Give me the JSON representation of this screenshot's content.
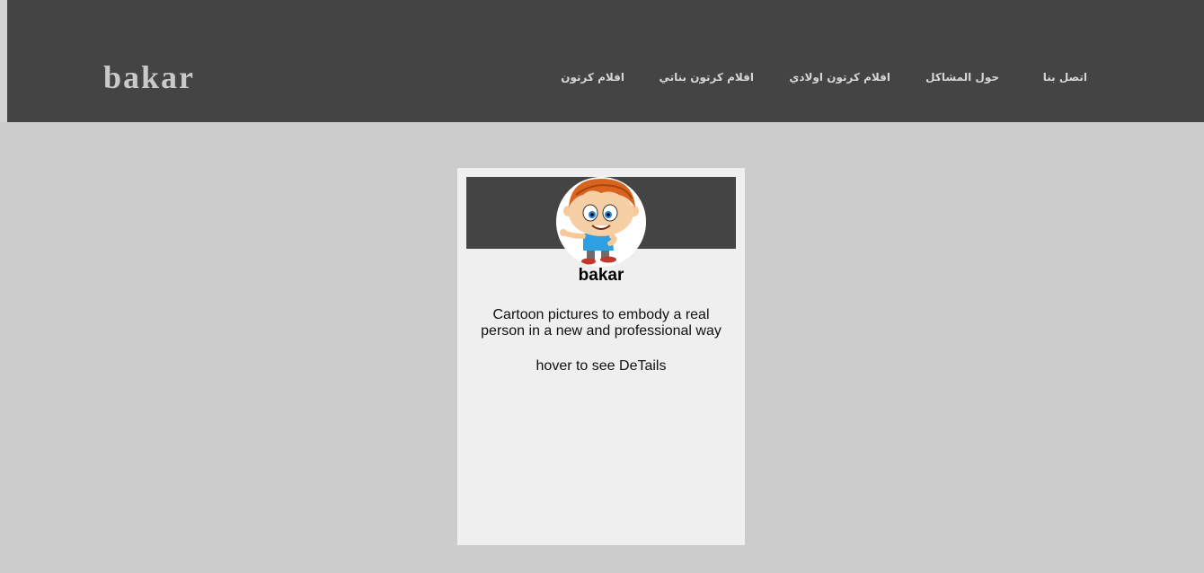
{
  "header": {
    "logo": "bakar",
    "nav": [
      {
        "label": "اتصل بنا"
      },
      {
        "label": "حول المشاكل"
      },
      {
        "label": "افلام كرتون اولادي"
      },
      {
        "label": "افلام كرتون بناتي"
      },
      {
        "label": "افلام كرتون"
      }
    ]
  },
  "card": {
    "name": "bakar",
    "description": "Cartoon pictures to embody a real person in a new and professional way",
    "hint": "hover to see DeTails",
    "avatar_icon": "cartoon-boy-avatar"
  },
  "colors": {
    "page_background": "#cccccc",
    "navbar": "#444444",
    "card": "#efefef",
    "nav_text": "#d6d6d6",
    "logo_text": "#c9c9c9"
  }
}
